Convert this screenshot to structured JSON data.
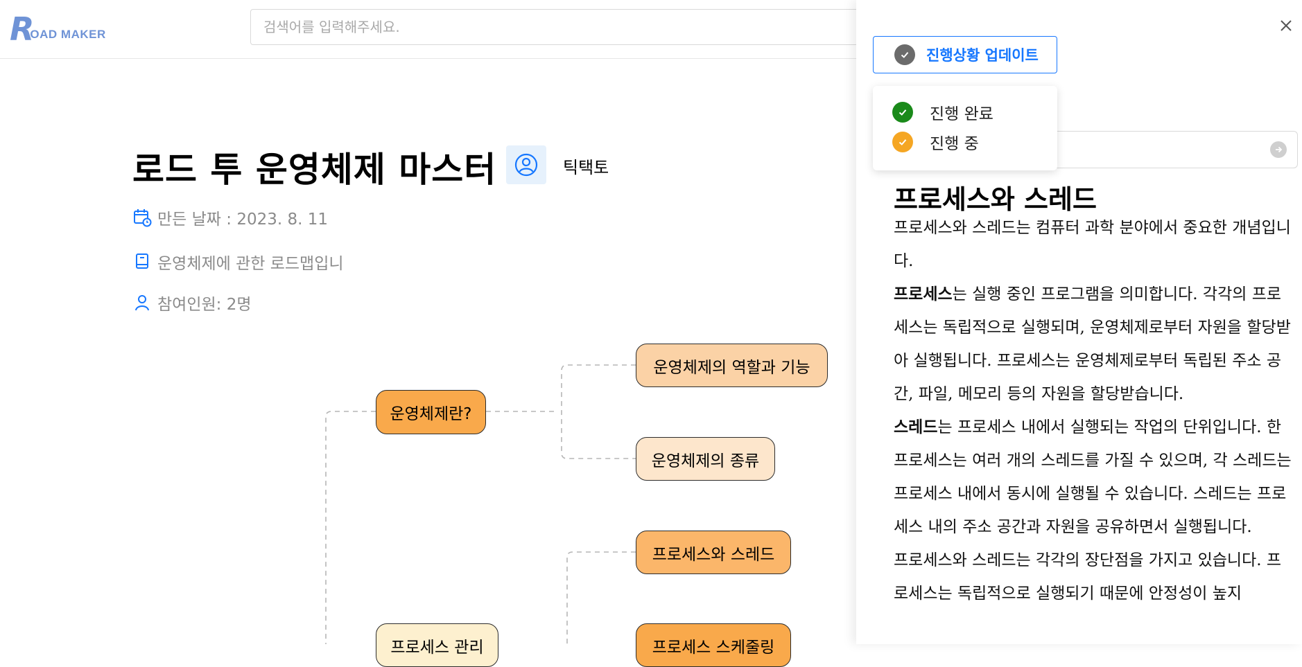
{
  "header": {
    "logo_letter": "R",
    "logo_text": "OAD MAKER",
    "search_placeholder": "검색어를 입력해주세요."
  },
  "roadmap": {
    "title": "로드 투 운영체제 마스터",
    "author": "틱택토",
    "created": "만든 날짜 : 2023. 8. 11",
    "description": "운영체제에 관한 로드맵입니",
    "participants": "참여인원: 2명"
  },
  "mindmap": {
    "nodes": {
      "what_is_os": "운영체제란?",
      "role_and_function": "운영체제의 역할과 기능",
      "os_types": "운영체제의 종류",
      "process_and_thread": "프로세스와 스레드",
      "process_management": "프로세스 관리",
      "process_scheduling": "프로세스 스케줄링"
    }
  },
  "panel": {
    "progress_button": "진행상황 업데이트",
    "status_options": [
      {
        "label": "진행 완료",
        "color": "#1a8a1a"
      },
      {
        "label": "진행 중",
        "color": "#f5a623"
      }
    ],
    "doc": {
      "title": "프로세스와 스레드",
      "p1": "프로세스와 스레드는 컴퓨터 과학 분야에서 중요한 개념입니다.",
      "p2_term": "프로세스",
      "p2_rest": "는 실행 중인 프로그램을 의미합니다. 각각의 프로세스는 독립적으로 실행되며, 운영체제로부터 자원을 할당받아 실행됩니다. 프로세스는 운영체제로부터 독립된 주소 공간, 파일, 메모리 등의 자원을 할당받습니다.",
      "p3_term": "스레드",
      "p3_rest": "는 프로세스 내에서 실행되는 작업의 단위입니다. 한 프로세스는 여러 개의 스레드를 가질 수 있으며, 각 스레드는 프로세스 내에서 동시에 실행될 수 있습니다. 스레드는 프로세스 내의 주소 공간과 자원을 공유하면서 실행됩니다.",
      "p4": "프로세스와 스레드는 각각의 장단점을 가지고 있습니다. 프로세스는 독립적으로 실행되기 때문에 안정성이 높지"
    }
  },
  "colors": {
    "accent": "#1677ff",
    "logo": "#6f93d6",
    "node_dark": "#f9a94b",
    "node_mid": "#fbd2a6",
    "node_light": "#fde6cc",
    "node_pale": "#fdf0cf"
  }
}
